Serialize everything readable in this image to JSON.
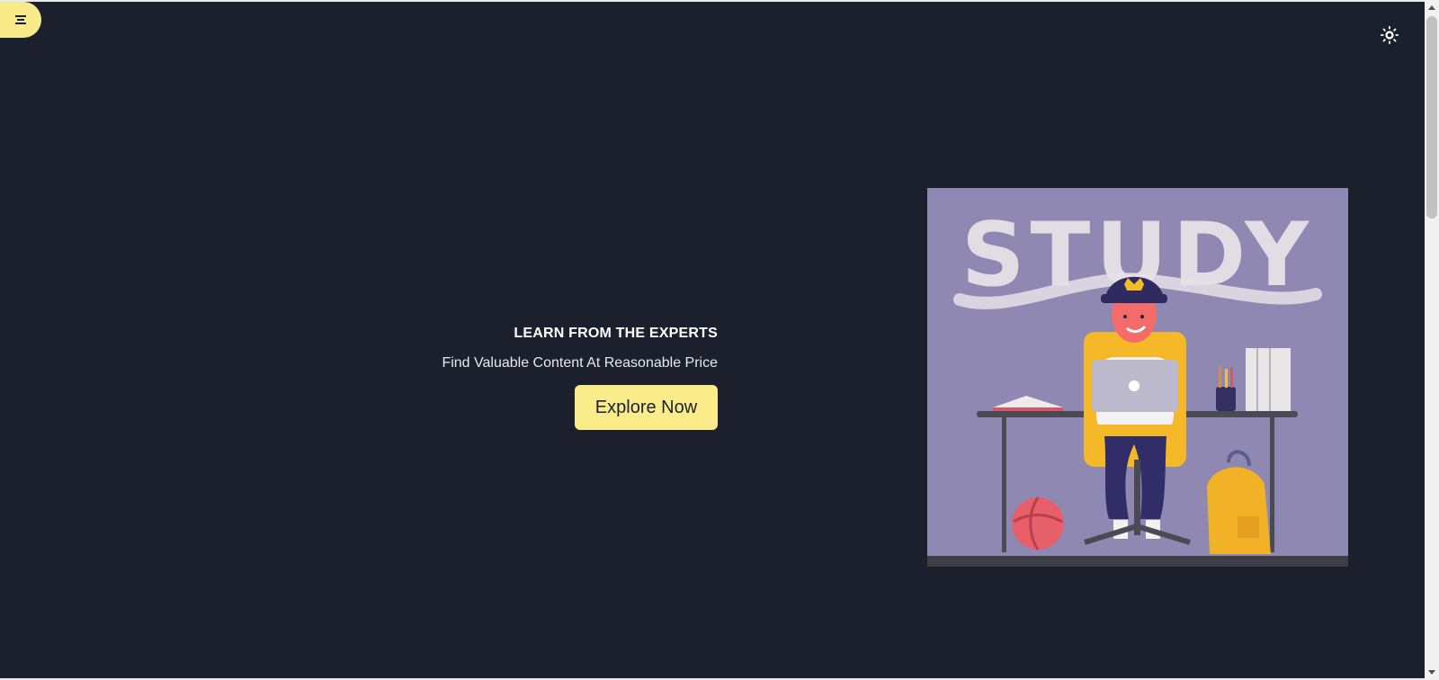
{
  "hero": {
    "title": "LEARN FROM THE EXPERTS",
    "subtitle": "Find Valuable Content At Reasonable Price",
    "button_label": "Explore Now",
    "image_text": "STUDY"
  },
  "icons": {
    "menu": "menu-icon",
    "theme": "sun-icon"
  },
  "colors": {
    "background": "#1b202c",
    "accent": "#faec8a",
    "image_bg": "#8f88b2"
  }
}
